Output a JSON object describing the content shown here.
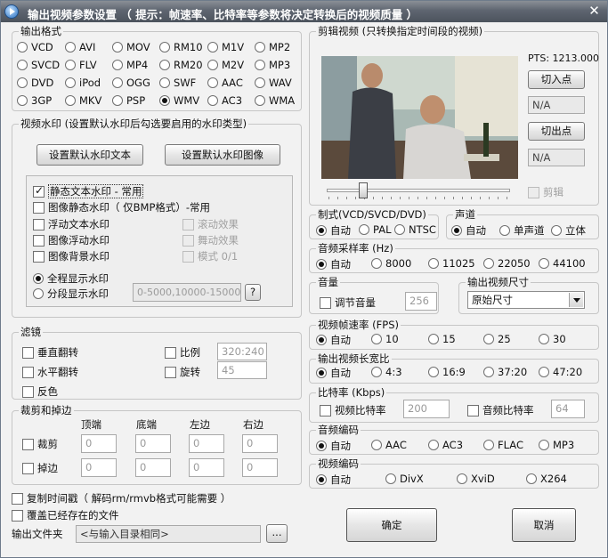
{
  "title": "输出视频参数设置 （ 提示：帧速率、比特率等参数将决定转换后的视频质量 ）",
  "output_format": {
    "title": "输出格式",
    "rows": [
      [
        "VCD",
        "AVI",
        "MOV",
        "RM10",
        "M1V",
        "MP2"
      ],
      [
        "SVCD",
        "FLV",
        "MP4",
        "RM20",
        "M2V",
        "MP3"
      ],
      [
        "DVD",
        "iPod",
        "OGG",
        "SWF",
        "AAC",
        "WAV"
      ],
      [
        "3GP",
        "MKV",
        "PSP",
        "WMV",
        "AC3",
        "WMA"
      ]
    ],
    "selected": "WMV"
  },
  "watermark": {
    "title": "视频水印 (设置默认水印后勾选要启用的水印类型)",
    "btn_text": "设置默认水印文本",
    "btn_image": "设置默认水印图像",
    "items": [
      "静态文本水印 - 常用",
      "图像静态水印（ 仅BMP格式）-常用",
      "浮动文本水印",
      "图像浮动水印",
      "图像背景水印"
    ],
    "sub_items": [
      "滚动效果",
      "舞动效果",
      "模式 0/1"
    ],
    "display_all": "全程显示水印",
    "display_segment": "分段显示水印",
    "segment_value": "0-5000,10000-15000",
    "help_btn": "?"
  },
  "filter": {
    "title": "滤镜",
    "flip_v": "垂直翻转",
    "flip_h": "水平翻转",
    "invert": "反色",
    "ratio": "比例",
    "ratio_value": "320:240",
    "rotate": "旋转",
    "rotate_value": "45"
  },
  "crop": {
    "title": "裁剪和掉边",
    "cols": [
      "顶端",
      "底端",
      "左边",
      "右边"
    ],
    "crop_label": "裁剪",
    "pad_label": "掉边",
    "crop_values": [
      "0",
      "0",
      "0",
      "0"
    ],
    "pad_values": [
      "0",
      "0",
      "0",
      "0"
    ]
  },
  "copy_timestamp": "复制时间戳（ 解码rm/rmvb格式可能需要 ）",
  "overwrite": "覆盖已经存在的文件",
  "output_folder": {
    "label": "输出文件夹",
    "value": "<与输入目录相同>",
    "browse": "..."
  },
  "clip": {
    "title": "剪辑视频 (只转换指定时间段的视频)",
    "pts": "PTS: 1213.000",
    "in_btn": "切入点",
    "in_value": "N/A",
    "out_btn": "切出点",
    "out_value": "N/A",
    "clip_check": "剪辑"
  },
  "standard": {
    "title": "制式(VCD/SVCD/DVD)",
    "options": [
      "自动",
      "PAL",
      "NTSC"
    ],
    "selected": "自动"
  },
  "channel": {
    "title": "声道",
    "options": [
      "自动",
      "单声道",
      "立体"
    ],
    "selected": "自动"
  },
  "sample_rate": {
    "title": "音频采样率 (Hz)",
    "options": [
      "自动",
      "8000",
      "11025",
      "22050",
      "44100"
    ],
    "selected": "自动"
  },
  "volume": {
    "title": "音量",
    "check": "调节音量",
    "value": "256"
  },
  "size": {
    "title": "输出视频尺寸",
    "value": "原始尺寸"
  },
  "fps": {
    "title": "视频帧速率 (FPS)",
    "options": [
      "自动",
      "10",
      "15",
      "25",
      "30"
    ],
    "selected": "自动"
  },
  "aspect": {
    "title": "输出视频长宽比",
    "options": [
      "自动",
      "4:3",
      "16:9",
      "37:20",
      "47:20"
    ],
    "selected": "自动"
  },
  "bitrate": {
    "title": "比特率 (Kbps)",
    "video_check": "视频比特率",
    "video_value": "200",
    "audio_check": "音频比特率",
    "audio_value": "64"
  },
  "audio_codec": {
    "title": "音频编码",
    "options": [
      "自动",
      "AAC",
      "AC3",
      "FLAC",
      "MP3"
    ],
    "selected": "自动"
  },
  "video_codec": {
    "title": "视频编码",
    "options": [
      "自动",
      "DivX",
      "XviD",
      "X264"
    ],
    "selected": "自动"
  },
  "ok": "确定",
  "cancel": "取消"
}
